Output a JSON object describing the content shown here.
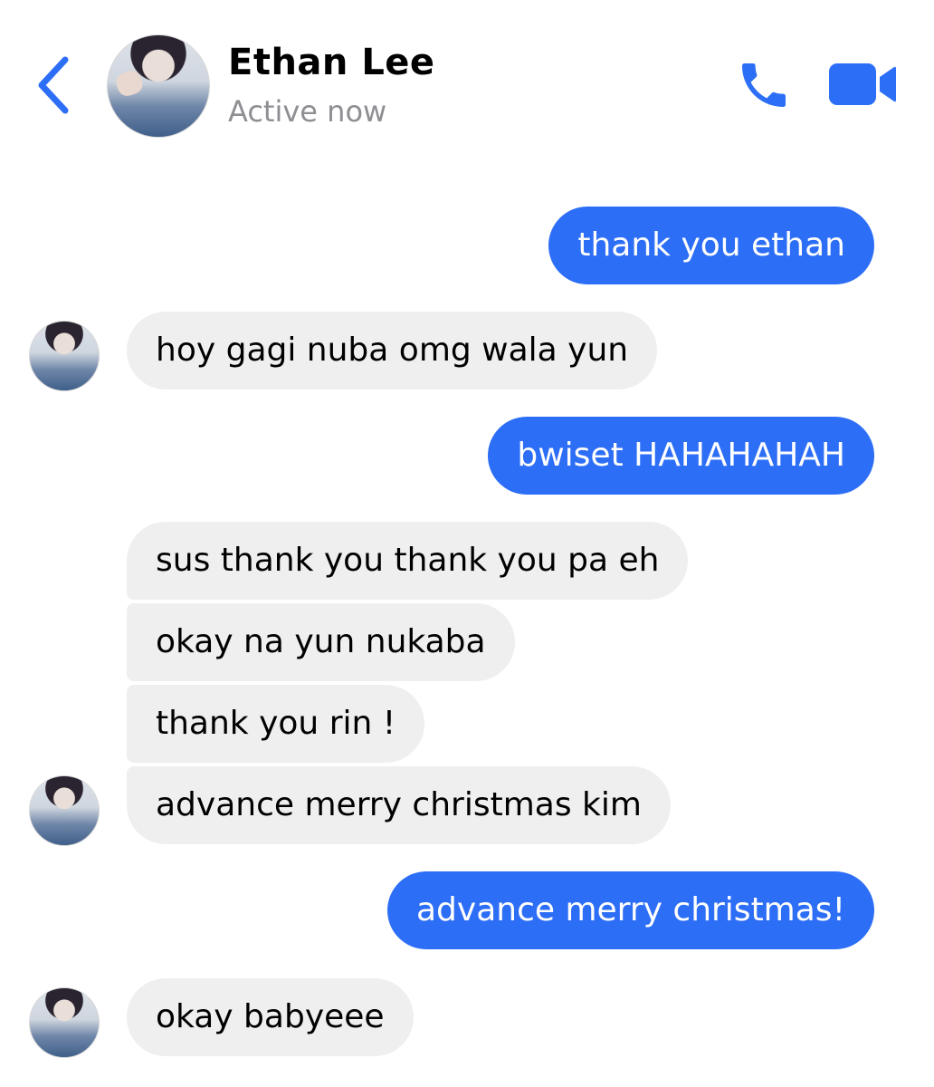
{
  "header": {
    "contact_name": "Ethan Lee",
    "status": "Active now",
    "accent_color": "#2D6EF6",
    "icons": [
      "chevron-left-icon",
      "phone-icon",
      "video-camera-icon"
    ]
  },
  "messages": [
    {
      "sender": "me",
      "text": "thank you ethan"
    },
    {
      "sender": "Ethan Lee",
      "text": "hoy gagi nuba omg wala yun"
    },
    {
      "sender": "me",
      "text": "bwiset HAHAHAHAH"
    },
    {
      "sender": "Ethan Lee",
      "text": "sus thank you thank you pa eh"
    },
    {
      "sender": "Ethan Lee",
      "text": "okay na yun nukaba"
    },
    {
      "sender": "Ethan Lee",
      "text": "thank you rin !"
    },
    {
      "sender": "Ethan Lee",
      "text": "advance merry christmas kim"
    },
    {
      "sender": "me",
      "text": "advance merry christmas!"
    },
    {
      "sender": "Ethan Lee",
      "text": "okay babyeee"
    }
  ]
}
